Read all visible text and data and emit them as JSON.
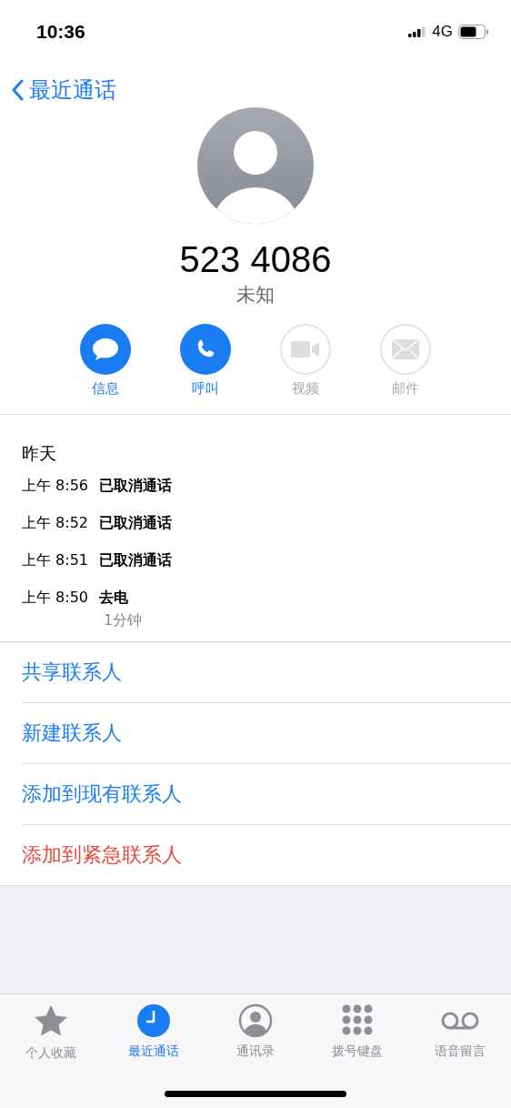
{
  "status_bar": {
    "time": "10:36",
    "network": "4G"
  },
  "nav": {
    "back_label": "最近通话"
  },
  "contact": {
    "number": "523 4086",
    "label": "未知"
  },
  "quick_actions": [
    {
      "kind": "message",
      "label": "信息",
      "disabled": false
    },
    {
      "kind": "call",
      "label": "呼叫",
      "disabled": false
    },
    {
      "kind": "video",
      "label": "视频",
      "disabled": true
    },
    {
      "kind": "mail",
      "label": "邮件",
      "disabled": true
    }
  ],
  "call_history": {
    "date": "昨天",
    "calls": [
      {
        "time": "上午 8:56",
        "status": "已取消通话"
      },
      {
        "time": "上午 8:52",
        "status": "已取消通话"
      },
      {
        "time": "上午 8:51",
        "status": "已取消通话"
      },
      {
        "time": "上午 8:50",
        "status": "去电",
        "duration": "1分钟"
      }
    ]
  },
  "actions": [
    {
      "label": "共享联系人",
      "kind": "normal"
    },
    {
      "label": "新建联系人",
      "kind": "normal"
    },
    {
      "label": "添加到现有联系人",
      "kind": "normal"
    },
    {
      "label": "添加到紧急联系人",
      "kind": "danger"
    }
  ],
  "tab_bar": [
    {
      "kind": "favorites",
      "label": "个人收藏",
      "selected": false
    },
    {
      "kind": "recents",
      "label": "最近通话",
      "selected": true
    },
    {
      "kind": "contacts",
      "label": "通讯录",
      "selected": false
    },
    {
      "kind": "keypad",
      "label": "拨号键盘",
      "selected": false
    },
    {
      "kind": "voicemail",
      "label": "语音留言",
      "selected": false
    }
  ]
}
